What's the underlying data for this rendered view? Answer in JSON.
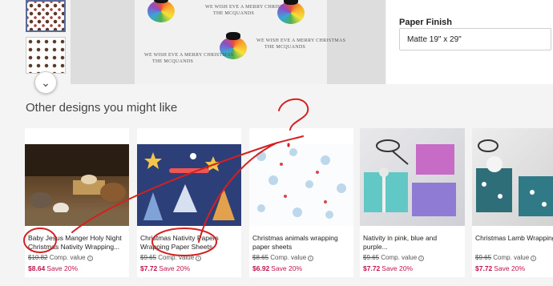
{
  "product": {
    "finish_label": "Paper Finish",
    "finish_value": "Matte 19\" x 29\"",
    "greeting": "WE WISH EVE A MERRY CHRISTMAS",
    "greeting_sub": "THE MCQUANDS"
  },
  "recommendations": {
    "title": "Other designs you might like",
    "items": [
      {
        "title": "Baby Jesus Manger Holy Night Christmas Nativity Wrapping...",
        "orig_price": "$10.82",
        "comp": "Comp. value",
        "price": "$8.64",
        "save": "Save 20%"
      },
      {
        "title": "Christmas Nativity Papers Wrapping Paper Sheets",
        "orig_price": "$9.65",
        "comp": "Comp. value",
        "price": "$7.72",
        "save": "Save 20%"
      },
      {
        "title": "Christmas animals wrapping paper sheets",
        "orig_price": "$8.65",
        "comp": "Comp. value",
        "price": "$6.92",
        "save": "Save 20%"
      },
      {
        "title": "Nativity in pink, blue and purple...",
        "orig_price": "$9.65",
        "comp": "Comp. value",
        "price": "$7.72",
        "save": "Save 20%"
      },
      {
        "title": "Christmas Lamb Wrapping",
        "orig_price": "$9.65",
        "comp": "Comp. value",
        "price": "$7.72",
        "save": "Save 20%"
      }
    ]
  },
  "annotation": {
    "mark": "?",
    "color": "#d42020"
  },
  "colors": {
    "sale": "#c1134a",
    "heading": "#444444"
  }
}
